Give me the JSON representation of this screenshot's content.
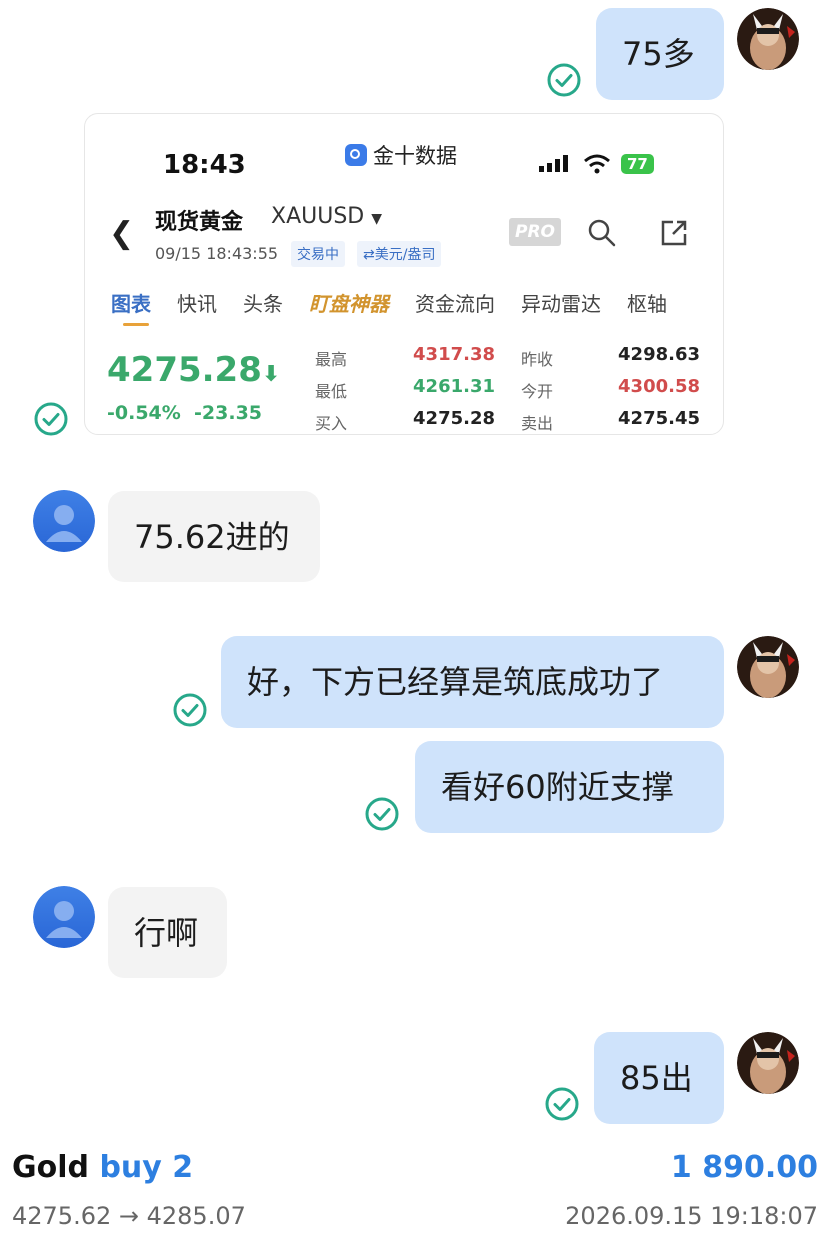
{
  "messages": {
    "m1": "75多",
    "m2": "75.62进的",
    "m3": "好，下方已经算是筑底成功了",
    "m4": "看好60附近支撑",
    "m5": "行啊",
    "m6": "85出"
  },
  "card": {
    "time": "18:43",
    "app_name": "金十数据",
    "battery": "77",
    "instrument_name": "现货黄金",
    "symbol": "XAUUSD",
    "datetime": "09/15 18:43:55",
    "tag_trading": "交易中",
    "tag_unit": "⇄美元/盎司",
    "pro": "PRO",
    "tabs": [
      "图表",
      "快讯",
      "头条",
      "盯盘神器",
      "资金流向",
      "异动雷达",
      "枢轴"
    ],
    "price": "4275.28",
    "change_pct": "-0.54%",
    "change_abs": "-23.35",
    "high_label": "最高",
    "high": "4317.38",
    "low_label": "最低",
    "low": "4261.31",
    "buy_label": "买入",
    "buy": "4275.28",
    "prev_label": "昨收",
    "prev": "4298.63",
    "open_label": "今开",
    "open": "4300.58",
    "sell_label": "卖出",
    "sell": "4275.45"
  },
  "footer": {
    "gold": "Gold",
    "side": "buy 2",
    "amount": "1 890.00",
    "range": "4275.62 → 4285.07",
    "date": "2026.09.15 19:18:07"
  },
  "colors": {
    "bubble_me": "#cfe3fb",
    "bubble_other": "#f3f3f3",
    "check": "#27a88a",
    "accent_blue": "#2d7fe0"
  }
}
